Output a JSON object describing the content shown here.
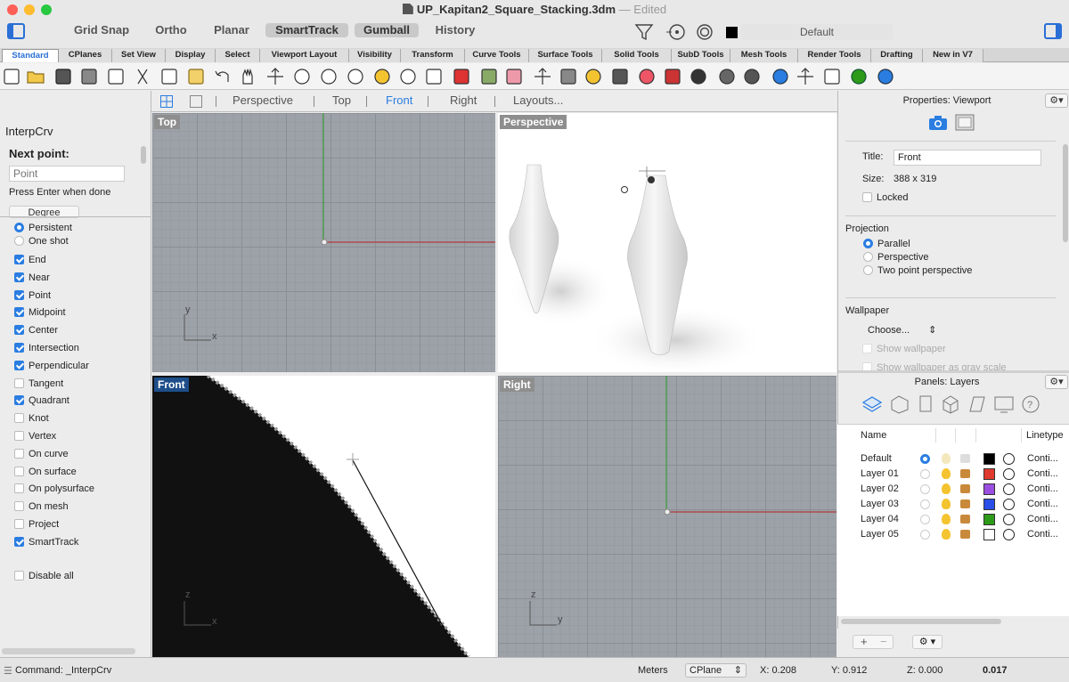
{
  "window": {
    "title": "UP_Kapitan2_Square_Stacking.3dm",
    "edited": "— Edited"
  },
  "toolbar": {
    "grid_snap": "Grid Snap",
    "ortho": "Ortho",
    "planar": "Planar",
    "smarttrack": "SmartTrack",
    "gumball": "Gumball",
    "history": "History",
    "current_layer": "Default"
  },
  "tabs": [
    "Standard",
    "CPlanes",
    "Set View",
    "Display",
    "Select",
    "Viewport Layout",
    "Visibility",
    "Transform",
    "Curve Tools",
    "Surface Tools",
    "Solid Tools",
    "SubD Tools",
    "Mesh Tools",
    "Render Tools",
    "Drafting",
    "New in V7"
  ],
  "command_panel": {
    "command_name": "InterpCrv",
    "prompt": "Next point:",
    "input_placeholder": "Point",
    "hint": "Press Enter when done",
    "option_button": "Degree"
  },
  "osnap": {
    "persistent": "Persistent",
    "one_shot": "One shot",
    "items": [
      {
        "label": "End",
        "checked": true
      },
      {
        "label": "Near",
        "checked": true
      },
      {
        "label": "Point",
        "checked": true
      },
      {
        "label": "Midpoint",
        "checked": true
      },
      {
        "label": "Center",
        "checked": true
      },
      {
        "label": "Intersection",
        "checked": true
      },
      {
        "label": "Perpendicular",
        "checked": true
      },
      {
        "label": "Tangent",
        "checked": false
      },
      {
        "label": "Quadrant",
        "checked": true
      },
      {
        "label": "Knot",
        "checked": false
      },
      {
        "label": "Vertex",
        "checked": false
      },
      {
        "label": "On curve",
        "checked": false
      },
      {
        "label": "On surface",
        "checked": false
      },
      {
        "label": "On polysurface",
        "checked": false
      },
      {
        "label": "On mesh",
        "checked": false
      },
      {
        "label": "Project",
        "checked": false
      },
      {
        "label": "SmartTrack",
        "checked": true
      }
    ],
    "disable_all": "Disable all"
  },
  "viewport_tabs": [
    "Perspective",
    "Top",
    "Front",
    "Right",
    "Layouts..."
  ],
  "viewports": {
    "top": "Top",
    "perspective": "Perspective",
    "front": "Front",
    "right": "Right",
    "axis_x": "x",
    "axis_y": "y",
    "axis_z": "z"
  },
  "properties": {
    "title": "Properties: Viewport",
    "title_label": "Title:",
    "title_value": "Front",
    "size_label": "Size:",
    "size_value": "388 x 319",
    "locked": "Locked",
    "projection_heading": "Projection",
    "projection_options": [
      {
        "label": "Parallel",
        "selected": true
      },
      {
        "label": "Perspective",
        "selected": false
      },
      {
        "label": "Two point perspective",
        "selected": false
      }
    ],
    "wallpaper_heading": "Wallpaper",
    "wallpaper_choose": "Choose...",
    "show_wallpaper": "Show wallpaper",
    "show_gray": "Show wallpaper as gray scale"
  },
  "layers": {
    "title": "Panels: Layers",
    "col_name": "Name",
    "col_linetype": "Linetype",
    "rows": [
      {
        "name": "Default",
        "current": true,
        "color": "#000000",
        "linetype": "Conti..."
      },
      {
        "name": "Layer 01",
        "current": false,
        "color": "#e03a2f",
        "linetype": "Conti..."
      },
      {
        "name": "Layer 02",
        "current": false,
        "color": "#9b4fe0",
        "linetype": "Conti..."
      },
      {
        "name": "Layer 03",
        "current": false,
        "color": "#2a4fe8",
        "linetype": "Conti..."
      },
      {
        "name": "Layer 04",
        "current": false,
        "color": "#2e9a1a",
        "linetype": "Conti..."
      },
      {
        "name": "Layer 05",
        "current": false,
        "color": "#ffffff",
        "linetype": "Conti..."
      }
    ]
  },
  "status": {
    "command": "Command: _InterpCrv",
    "units": "Meters",
    "cplane": "CPlane",
    "x": "X: 0.208",
    "y": "Y: 0.912",
    "z": "Z: 0.000",
    "value": "0.017"
  }
}
